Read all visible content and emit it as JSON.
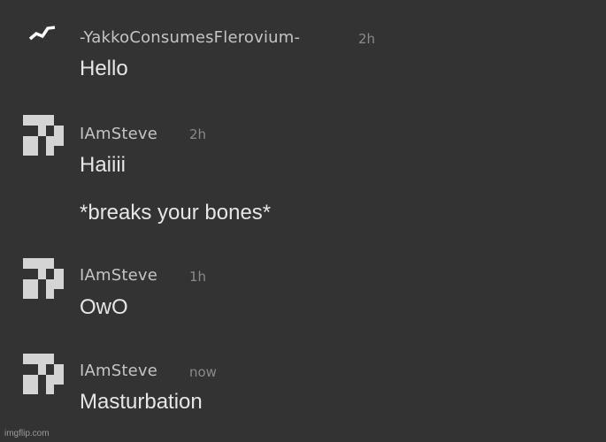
{
  "messages": [
    {
      "username": "-YakkoConsumesFlerovium-",
      "time": "2h",
      "avatar_icon": "lightning-icon",
      "lines": [
        "Hello"
      ]
    },
    {
      "username": "IAmSteve",
      "time": "2h",
      "avatar_icon": "blocky-avatar-icon",
      "lines": [
        "Haiiii",
        "*breaks your bones*"
      ]
    },
    {
      "username": "IAmSteve",
      "time": "1h",
      "avatar_icon": "blocky-avatar-icon",
      "lines": [
        "OwO"
      ]
    },
    {
      "username": "IAmSteve",
      "time": "now",
      "avatar_icon": "blocky-avatar-icon",
      "lines": [
        "Masturbation"
      ]
    }
  ],
  "watermark": "imgflip.com",
  "colors": {
    "background": "#333333",
    "username": "#c4c4c4",
    "timestamp": "#8a8a8a",
    "message_text": "#e6e6e6",
    "avatar": "#d4d4d4"
  }
}
